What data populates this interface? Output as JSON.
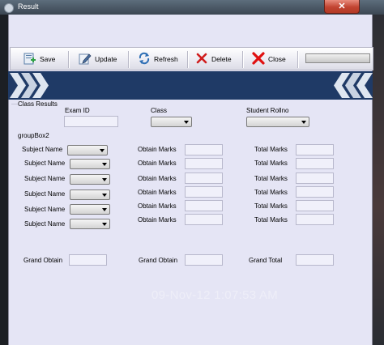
{
  "window": {
    "title": "Result",
    "close_glyph": "✕"
  },
  "toolbar": {
    "buttons": [
      {
        "label": "Save",
        "icon": "save-plus-icon"
      },
      {
        "label": "Update",
        "icon": "edit-icon"
      },
      {
        "label": "Refresh",
        "icon": "refresh-icon"
      },
      {
        "label": "Delete",
        "icon": "delete-x-icon"
      },
      {
        "label": "Close",
        "icon": "close-x-icon"
      }
    ]
  },
  "class_results": {
    "title": "Class Results",
    "exam_id_label": "Exam ID",
    "class_label": "Class",
    "student_rollno_label": "Student Rollno"
  },
  "groupbox2": {
    "title": "groupBox2",
    "subject_label": "Subject Name",
    "obtain_label": "Obtain Marks",
    "total_label": "Total Marks"
  },
  "grand": {
    "obtain_left_label": "Grand Obtain",
    "obtain_mid_label": "Grand Obtain",
    "total_label": "Grand Total"
  },
  "datetime": "09-Nov-12 1:07:53 AM",
  "colors": {
    "banner": "#1f3a66",
    "window_bg": "#e5e5f5",
    "close_button": "#c24431"
  }
}
